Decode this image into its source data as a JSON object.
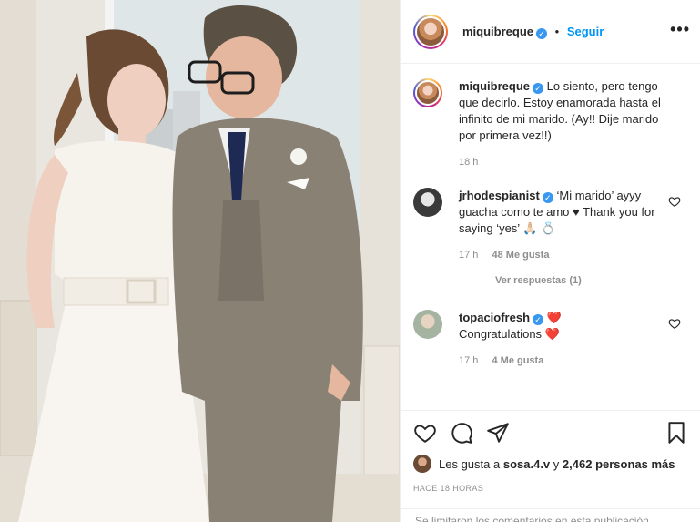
{
  "post": {
    "username": "miquibreque",
    "follow_label": "Seguir",
    "more_label": "•••"
  },
  "caption": {
    "username": "miquibreque",
    "text": "Lo siento, pero tengo que decirlo. Estoy enamorada hasta el infinito de mi marido. (Ay!! Dije marido por primera vez!!)",
    "time": "18 h"
  },
  "comments": [
    {
      "username": "jrhodespianist",
      "text": "‘Mi marido’ ayyy guacha como te amo ♥ Thank you for saying ‘yes’ 🙏🏻 💍",
      "time": "17 h",
      "likes": "48 Me gusta",
      "replies": "Ver respuestas (1)"
    },
    {
      "username": "topaciofresh",
      "text_pre": "❤️",
      "text": "Congratulations ❤️",
      "time": "17 h",
      "likes": "4 Me gusta"
    }
  ],
  "likes": {
    "prefix": "Les gusta a",
    "user": "sosa.4.v",
    "middle": "y",
    "count": "2,462 personas más"
  },
  "timestamp": "HACE 18 HORAS",
  "comments_closed": "Se limitaron los comentarios en esta publicación.",
  "colors": {
    "accent": "#0095f6",
    "verified": "#3897f0",
    "heart": "#ed4956"
  }
}
